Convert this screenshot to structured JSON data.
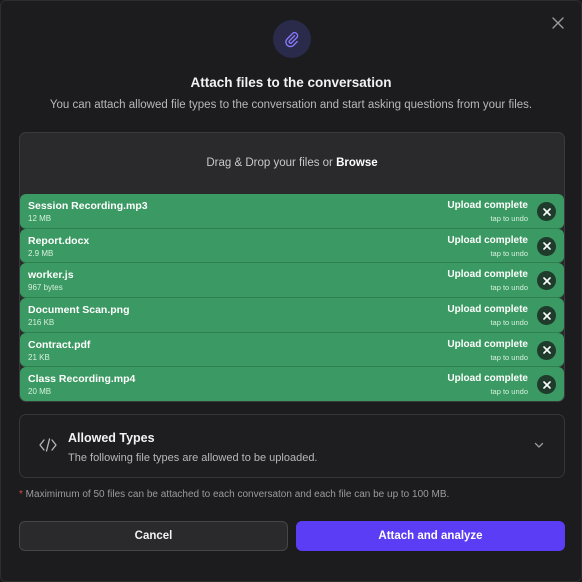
{
  "header": {
    "title": "Attach files to the conversation",
    "subtitle": "You can attach allowed file types to the conversation and start asking questions from your files."
  },
  "dropzone": {
    "prefix": "Drag & Drop your files or ",
    "browse_label": "Browse"
  },
  "files": [
    {
      "name": "Session Recording.mp3",
      "size": "12 MB",
      "status": "Upload complete",
      "undo": "tap to undo"
    },
    {
      "name": "Report.docx",
      "size": "2.9 MB",
      "status": "Upload complete",
      "undo": "tap to undo"
    },
    {
      "name": "worker.js",
      "size": "967 bytes",
      "status": "Upload complete",
      "undo": "tap to undo"
    },
    {
      "name": "Document Scan.png",
      "size": "216 KB",
      "status": "Upload complete",
      "undo": "tap to undo"
    },
    {
      "name": "Contract.pdf",
      "size": "21 KB",
      "status": "Upload complete",
      "undo": "tap to undo"
    },
    {
      "name": "Class Recording.mp4",
      "size": "20 MB",
      "status": "Upload complete",
      "undo": "tap to undo"
    }
  ],
  "allowed_types": {
    "title": "Allowed Types",
    "description": "The following file types are allowed to be uploaded."
  },
  "note": {
    "star": "*",
    "text": " Maximimum of 50 files can be attached to each conversaton and each file can be up to 100 MB."
  },
  "actions": {
    "cancel_label": "Cancel",
    "attach_label": "Attach and analyze"
  },
  "colors": {
    "accent": "#5b3df5",
    "success": "#3b9a63"
  },
  "icons": {
    "header": "paperclip-icon",
    "close": "close-icon",
    "remove": "close-icon",
    "allowed": "code-icon",
    "expand": "chevron-down-icon"
  }
}
